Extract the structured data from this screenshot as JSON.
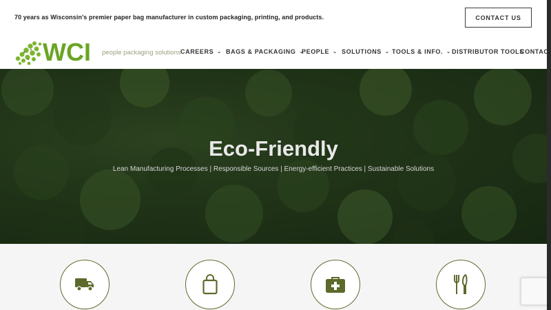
{
  "topbar": {
    "tagline": "70 years as Wisconsin's premier paper bag manufacturer in custom packaging, printing, and products.",
    "contact_label": "CONTACT US"
  },
  "logo": {
    "text": "WCI",
    "tagline": "people packaging solutions"
  },
  "nav": [
    {
      "label": "CAREERS",
      "has_dropdown": true
    },
    {
      "label": "BAGS & PACKAGING",
      "has_dropdown": true
    },
    {
      "label": "PEOPLE",
      "has_dropdown": true
    },
    {
      "label": "SOLUTIONS",
      "has_dropdown": true
    },
    {
      "label": "TOOLS & INFO.",
      "has_dropdown": true
    },
    {
      "label": "DISTRIBUTOR TOOLS",
      "has_dropdown": false
    },
    {
      "label": "CONTACT",
      "has_dropdown": false
    }
  ],
  "hero": {
    "title": "Eco-Friendly",
    "subtitle": "Lean Manufacturing Processes | Responsible Sources | Energy-efficient Practices | Sustainable Solutions"
  },
  "features": [
    {
      "icon": "truck-icon"
    },
    {
      "icon": "shopping-bag-icon"
    },
    {
      "icon": "medical-kit-icon"
    },
    {
      "icon": "utensils-icon"
    }
  ],
  "colors": {
    "accent_green": "#5c6a2b",
    "logo_green": "#7db52e",
    "text_dark": "#333333"
  }
}
